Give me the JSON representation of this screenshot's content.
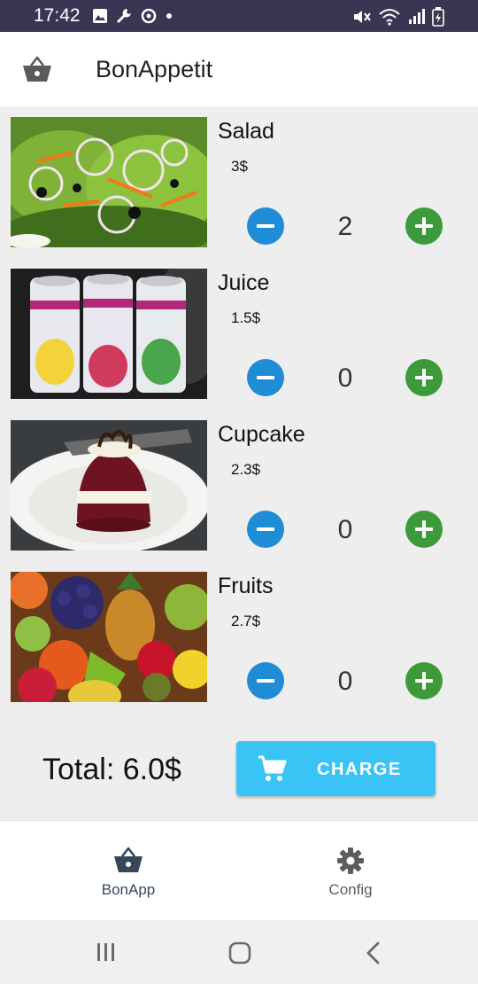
{
  "status_bar": {
    "time": "17:42"
  },
  "app_bar": {
    "title": "BonAppetit",
    "icon": "basket-icon"
  },
  "items": [
    {
      "name": "Salad",
      "price": "3$",
      "quantity": "2"
    },
    {
      "name": "Juice",
      "price": "1.5$",
      "quantity": "0"
    },
    {
      "name": "Cupcake",
      "price": "2.3$",
      "quantity": "0"
    },
    {
      "name": "Fruits",
      "price": "2.7$",
      "quantity": "0"
    }
  ],
  "footer": {
    "total": "Total: 6.0$",
    "charge_label": "CHARGE"
  },
  "bottom_nav": [
    {
      "label": "BonApp",
      "icon": "basket-icon",
      "active": true
    },
    {
      "label": "Config",
      "icon": "gear-icon",
      "active": false
    }
  ],
  "colors": {
    "minus_button": "#1f8dd6",
    "plus_button": "#3c9a3b",
    "charge_button": "#3ac4f6",
    "status_bar": "#3a3552",
    "active_nav": "#37475a"
  }
}
